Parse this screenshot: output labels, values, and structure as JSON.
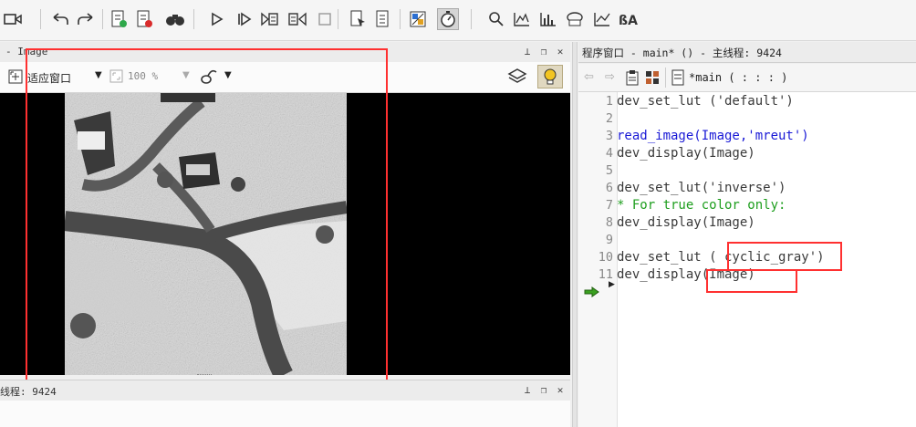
{
  "image_panel": {
    "title": "- Image",
    "fit_label": "适应窗口",
    "zoom_label": "100 %"
  },
  "bottom_panel": {
    "title": "线程: 9424"
  },
  "code_panel": {
    "title": "程序窗口 - main* () - 主线程: 9424",
    "proc_label": "*main ( : : : )",
    "lines": [
      {
        "no": "1",
        "text": "dev_set_lut ('default')"
      },
      {
        "no": "2",
        "text": ""
      },
      {
        "no": "3",
        "text": "read_image(Image,'mreut')"
      },
      {
        "no": "4",
        "text": "dev_display(Image)"
      },
      {
        "no": "5",
        "text": ""
      },
      {
        "no": "6",
        "text": "dev_set_lut('inverse')"
      },
      {
        "no": "7",
        "text": "* For true color only:"
      },
      {
        "no": "8",
        "text": "dev_display(Image)"
      },
      {
        "no": "9",
        "text": ""
      },
      {
        "no": "10",
        "text": "dev_set_lut ( cyclic_gray')"
      },
      {
        "no": "11",
        "text": "dev_display(Image)"
      }
    ]
  },
  "colors": {
    "keyword_blue": "#1a1ad6",
    "comment_green": "#1e9e1e",
    "annotation_red": "#ff3030",
    "accent_yellow": "#f3c522"
  }
}
